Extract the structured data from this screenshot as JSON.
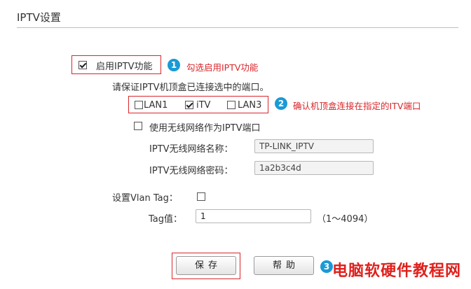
{
  "page": {
    "title": "IPTV设置"
  },
  "enable": {
    "label": "启用IPTV功能",
    "checked": true
  },
  "hints": {
    "step1": {
      "number": "1",
      "text": "勾选启用IPTV功能"
    },
    "step2": {
      "number": "2",
      "text": "确认机顶盒连接在指定的ITV端口"
    },
    "step3": {
      "number": "3"
    }
  },
  "port_section": {
    "instruction": "请保证IPTV机顶盒已连接选中的端口。",
    "ports": [
      {
        "label": "LAN1",
        "checked": false
      },
      {
        "label": "iTV",
        "checked": true
      },
      {
        "label": "LAN3",
        "checked": false
      }
    ]
  },
  "wireless": {
    "label": "使用无线网络作为IPTV端口",
    "checked": false,
    "ssid_label": "IPTV无线网络名称：",
    "ssid_value": "TP-LINK_IPTV",
    "password_label": "IPTV无线网络密码：",
    "password_value": "1a2b3c4d"
  },
  "vlan": {
    "label": "设置Vlan Tag：",
    "checked": false,
    "tag_label": "Tag值：",
    "tag_value": "1",
    "range_hint": "（1～4094）"
  },
  "buttons": {
    "save": "保存",
    "help": "帮助"
  },
  "watermark": "电脑软硬件教程网"
}
